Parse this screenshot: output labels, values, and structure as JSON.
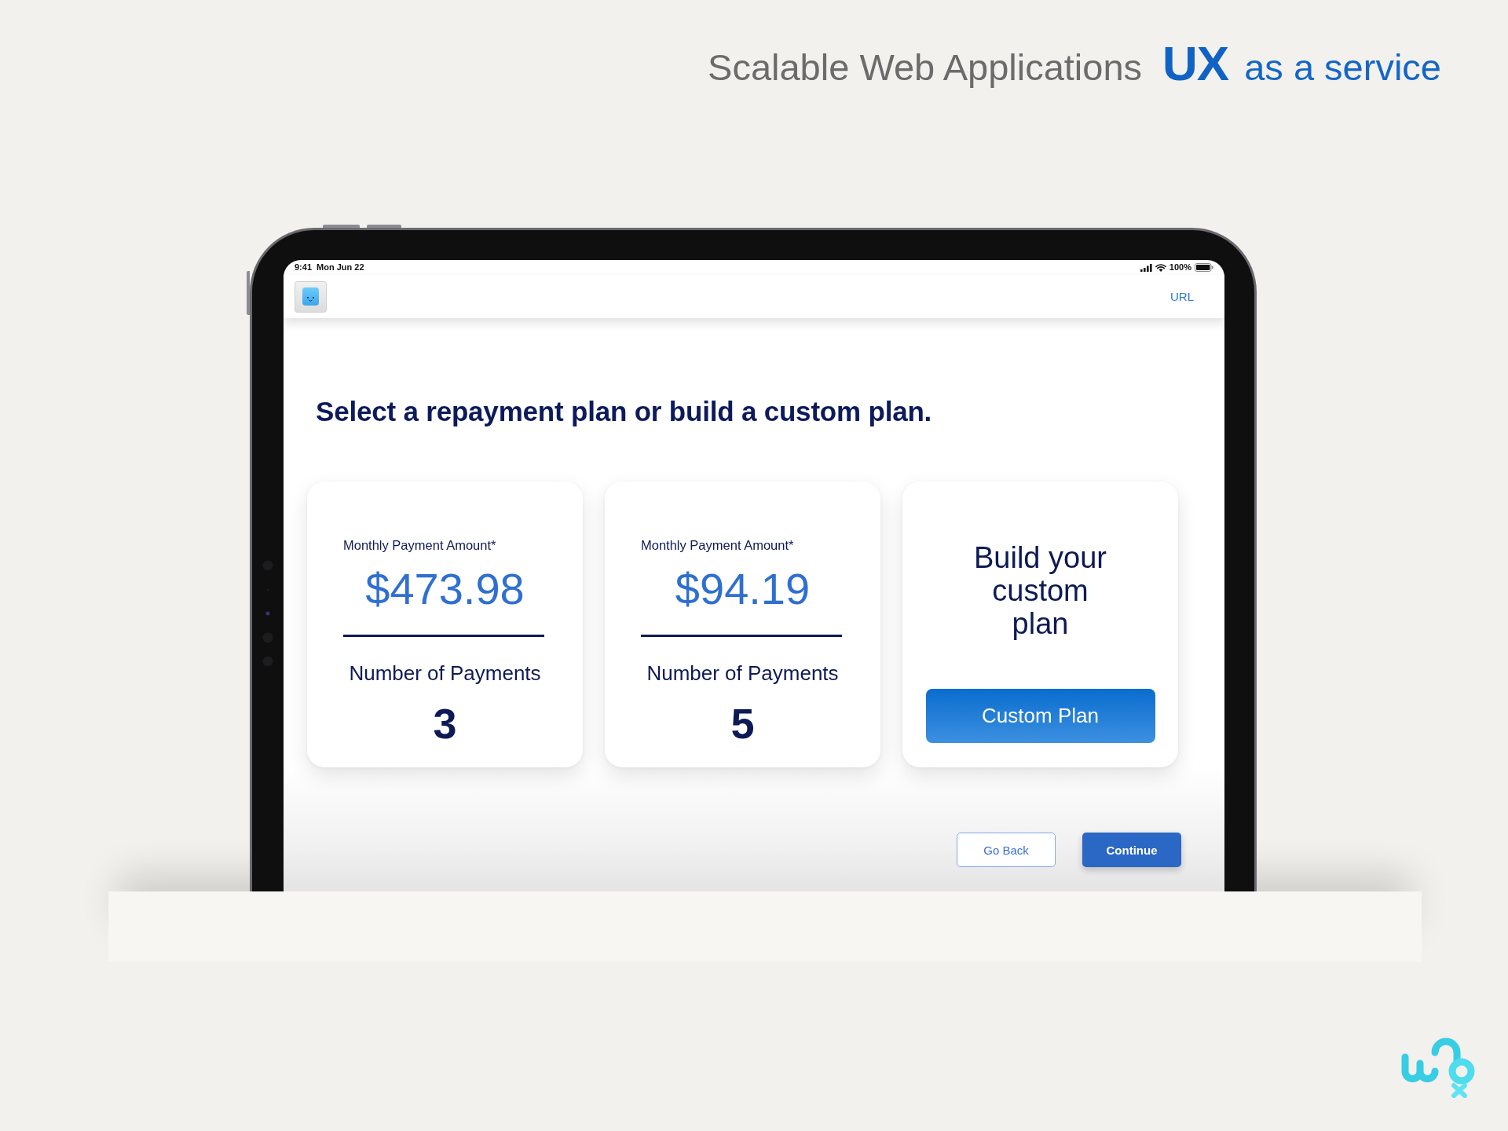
{
  "header": {
    "title": "Scalable Web Applications",
    "mark": "UX",
    "tagline": "as a service"
  },
  "status_bar": {
    "time": "9:41",
    "date": "Mon Jun 22",
    "battery": "100%"
  },
  "app_bar": {
    "link": "URL"
  },
  "heading": "Select a repayment plan or build a custom plan.",
  "plans": [
    {
      "kind": "plan",
      "amount_label": "Monthly Payment Amount*",
      "amount": "$473.98",
      "count_label": "Number of Payments",
      "count": "3"
    },
    {
      "kind": "plan",
      "amount_label": "Monthly Payment Amount*",
      "amount": "$94.19",
      "count_label": "Number of Payments",
      "count": "5"
    },
    {
      "kind": "custom",
      "title": "Build your custom plan",
      "button": "Custom Plan"
    }
  ],
  "actions": [
    {
      "kind": "secondary",
      "label": "Go Back"
    },
    {
      "kind": "primary",
      "label": "Continue"
    }
  ]
}
